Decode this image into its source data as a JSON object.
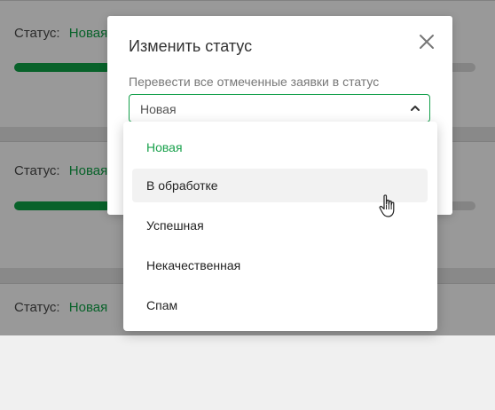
{
  "background": {
    "status_label": "Статус:",
    "status_value": "Новая",
    "progress_fraction": 0.21
  },
  "modal": {
    "title": "Изменить статус",
    "field_label": "Перевести все отмеченные заявки в статус",
    "selected_value": "Новая",
    "close_icon": "close-icon",
    "chevron_icon": "chevron-up-icon"
  },
  "dropdown": {
    "options": [
      "Новая",
      "В обработке",
      "Успешная",
      "Некачественная",
      "Спам"
    ],
    "selected_index": 0,
    "hovered_index": 1
  },
  "colors": {
    "accent": "#14a04b",
    "progress": "#0e9a43"
  }
}
